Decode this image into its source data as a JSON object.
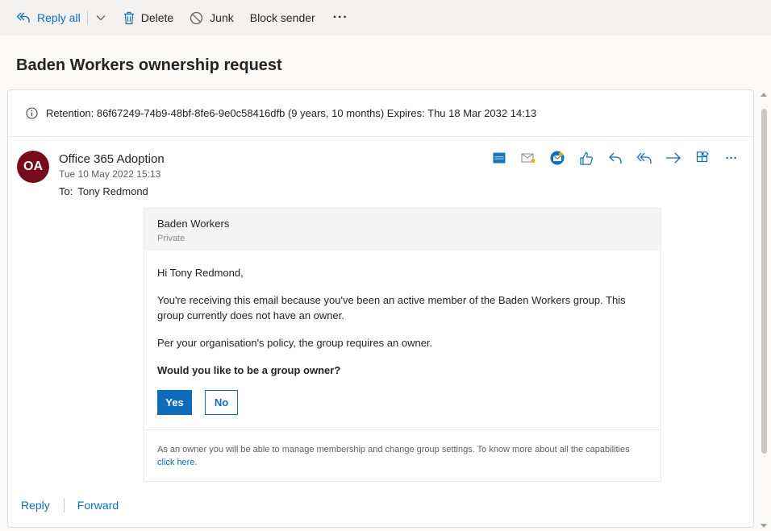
{
  "toolbar": {
    "reply_all": "Reply all",
    "delete": "Delete",
    "junk": "Junk",
    "block_sender": "Block sender",
    "more": "···"
  },
  "subject": "Baden Workers ownership request",
  "retention": {
    "text": "Retention: 86f67249-74b9-48bf-8fe6-9e0c58416dfb (9 years, 10 months) Expires: Thu 18 Mar 2032 14:13"
  },
  "message": {
    "avatar_initials": "OA",
    "sender": "Office 365 Adoption",
    "date": "Tue 10 May 2022 15:13",
    "to_label": "To:",
    "to_name": "Tony Redmond"
  },
  "actions": {
    "more": "···"
  },
  "card": {
    "group_name": "Baden Workers",
    "group_privacy": "Private",
    "greeting": "Hi Tony Redmond,",
    "para1": "You're receiving this email because you've been an active member of the Baden Workers group. This group currently does not have an owner.",
    "para2": "Per your organisation's policy, the group requires an owner.",
    "question": "Would you like to be a group owner?",
    "yes": "Yes",
    "no": "No",
    "footer_text": "As an owner you will be able to manage membership and change group settings. To know more about all the capabilities ",
    "footer_link": "click here",
    "footer_end": "."
  },
  "bottom": {
    "reply": "Reply",
    "forward": "Forward"
  },
  "colors": {
    "accent": "#0f6cbd",
    "avatar_bg": "#750b1c"
  }
}
